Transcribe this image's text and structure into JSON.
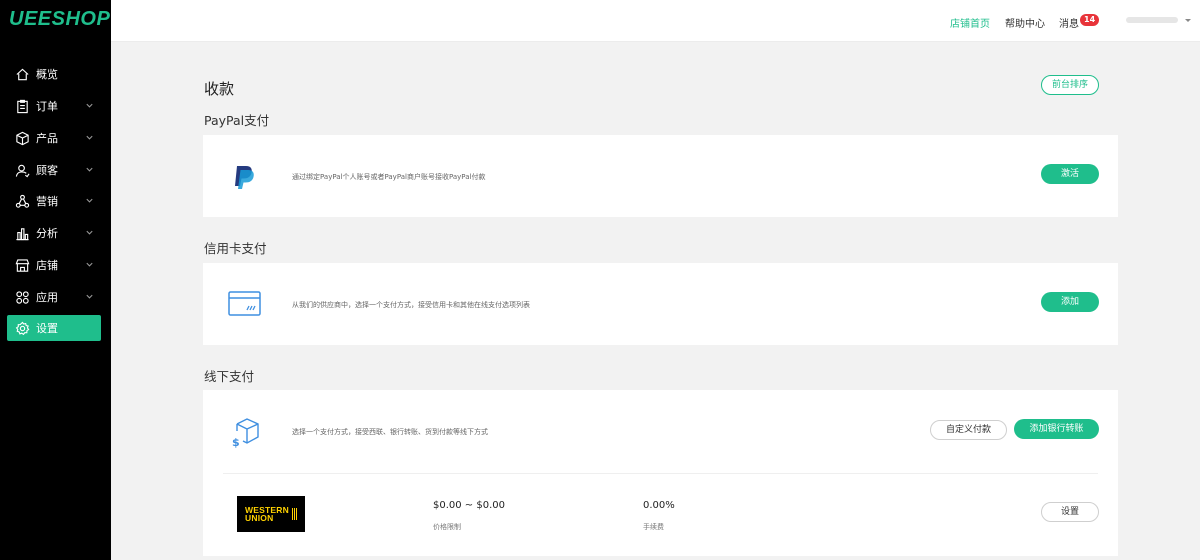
{
  "app": {
    "logo": "UEESHOP",
    "brand_color": "#1fbe8c"
  },
  "sidebar": {
    "items": [
      {
        "label": "概览",
        "icon": "home-icon",
        "has_submenu": false,
        "active": false
      },
      {
        "label": "订单",
        "icon": "clipboard-icon",
        "has_submenu": true,
        "active": false
      },
      {
        "label": "产品",
        "icon": "box-icon",
        "has_submenu": true,
        "active": false
      },
      {
        "label": "顾客",
        "icon": "user-icon",
        "has_submenu": true,
        "active": false
      },
      {
        "label": "营销",
        "icon": "marketing-icon",
        "has_submenu": true,
        "active": false
      },
      {
        "label": "分析",
        "icon": "bar-chart-icon",
        "has_submenu": true,
        "active": false
      },
      {
        "label": "店铺",
        "icon": "store-icon",
        "has_submenu": true,
        "active": false
      },
      {
        "label": "应用",
        "icon": "apps-icon",
        "has_submenu": true,
        "active": false
      },
      {
        "label": "设置",
        "icon": "gear-icon",
        "has_submenu": false,
        "active": true
      }
    ]
  },
  "topbar": {
    "store_home": "店铺首页",
    "help_center": "帮助中心",
    "messages": "消息",
    "message_count": "14"
  },
  "main": {
    "title": "收款",
    "sort_button": "前台排序",
    "sections": {
      "paypal": {
        "title": "PayPal支付",
        "description": "通过绑定PayPal个人账号或者PayPal商户账号接收PayPal付款",
        "button": "激活",
        "icon": "paypal-logo-icon"
      },
      "credit_card": {
        "title": "信用卡支付",
        "description": "从我们的供应商中，选择一个支付方式，接受信用卡和其他在线支付选项列表",
        "button": "添加",
        "icon": "credit-card-icon"
      },
      "offline": {
        "title": "线下支付",
        "description": "选择一个支付方式，接受西联、银行转账、货到付款等线下方式",
        "custom_button": "自定义付款",
        "bank_button": "添加银行转账",
        "icon": "dollar-box-icon",
        "methods": [
          {
            "logo_line1": "WESTERN",
            "logo_line2": "UNION",
            "price_range": "$0.00 ~ $0.00",
            "price_label": "价格限制",
            "fee": "0.00%",
            "fee_label": "手续费",
            "button": "设置"
          }
        ]
      }
    }
  }
}
